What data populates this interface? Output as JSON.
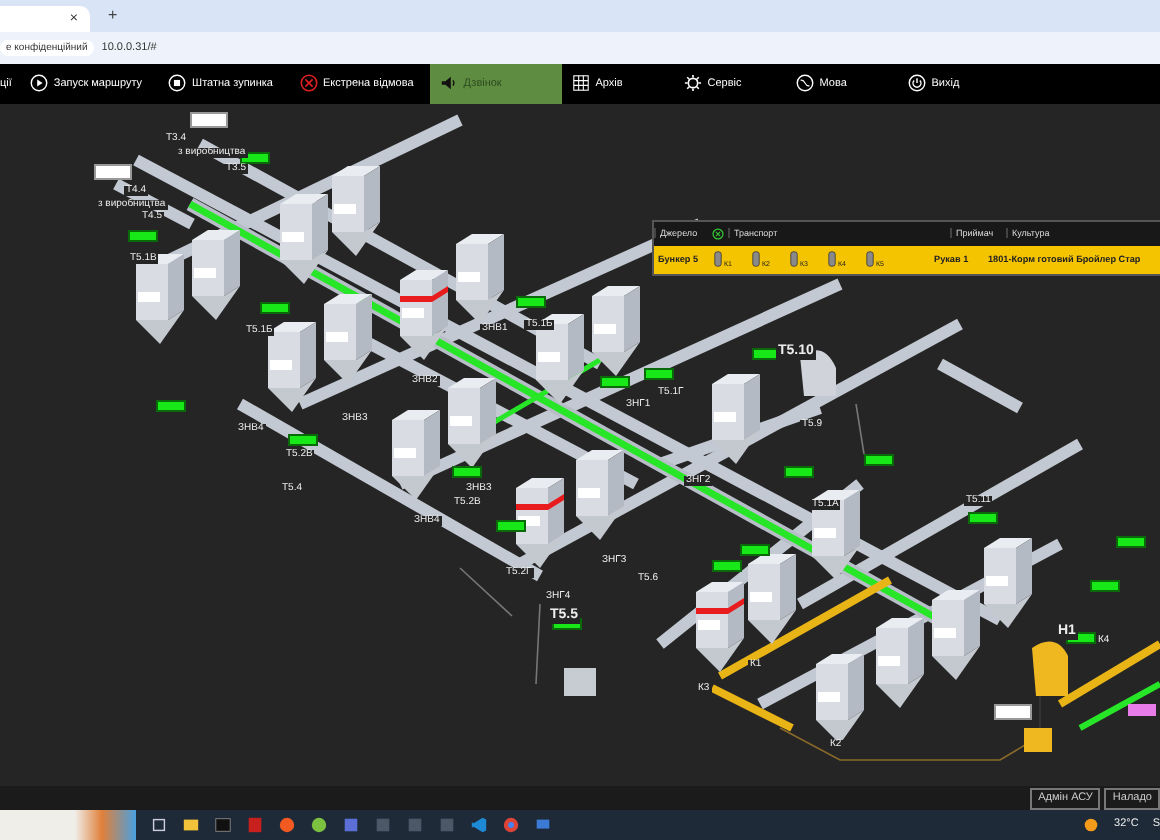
{
  "browser": {
    "tab_close": "×",
    "new_tab": "+",
    "security_chip": "е конфіденційний",
    "url": "10.0.0.31/#"
  },
  "toolbar": [
    {
      "label": "ції",
      "kind": "none",
      "selected": false
    },
    {
      "label": "Запуск маршруту",
      "kind": "play",
      "selected": false
    },
    {
      "label": "Штатна зупинка",
      "kind": "stop",
      "selected": false
    },
    {
      "label": "Екстрена відмова",
      "kind": "cancel",
      "selected": false
    },
    {
      "label": "Дзвінок",
      "kind": "speaker",
      "selected": true
    },
    {
      "label": "Архів",
      "kind": "grid",
      "selected": false
    },
    {
      "label": "Сервіс",
      "kind": "gear",
      "selected": false
    },
    {
      "label": "Мова",
      "kind": "globe",
      "selected": false
    },
    {
      "label": "Вихід",
      "kind": "power",
      "selected": false
    }
  ],
  "route_table": {
    "columns": [
      "Джерело",
      "Транспорт",
      "Приймач",
      "Культура"
    ],
    "row": {
      "source": "Бункер 5",
      "transport": [
        "К1",
        "К2",
        "К3",
        "К4",
        "К5"
      ],
      "receiver": "Рукав 1",
      "culture": "1801-Корм готовий Бройлер Стар"
    }
  },
  "scheme": {
    "labels": [
      "T3.4",
      "з виробництва",
      "T4.4",
      "з виробництва",
      "T3.5",
      "T4.5",
      "T5.1В",
      "T5.1Б",
      "ЗНВ1",
      "T5.1Б",
      "ЗНВ2",
      "ЗНВ3",
      "ЗНВ4",
      "T5.2В",
      "T5.4",
      "ЗНВ3",
      "T5.2В",
      "ЗНВ4",
      "T5.2Г",
      "ЗНГ4",
      "T5.5",
      "T5.10",
      "T5.9",
      "ЗНГ1",
      "T5.1Г",
      "ЗНГ2",
      "ЗНГ3",
      "T5.6",
      "T5.1А",
      "T5.11",
      "H1",
      "К1",
      "К2",
      "К3",
      "К4"
    ]
  },
  "status_bar": [
    "Адмін АСУ",
    "Наладо"
  ],
  "taskbar": {
    "temperature": "32°C",
    "clock_fragment": "S"
  }
}
